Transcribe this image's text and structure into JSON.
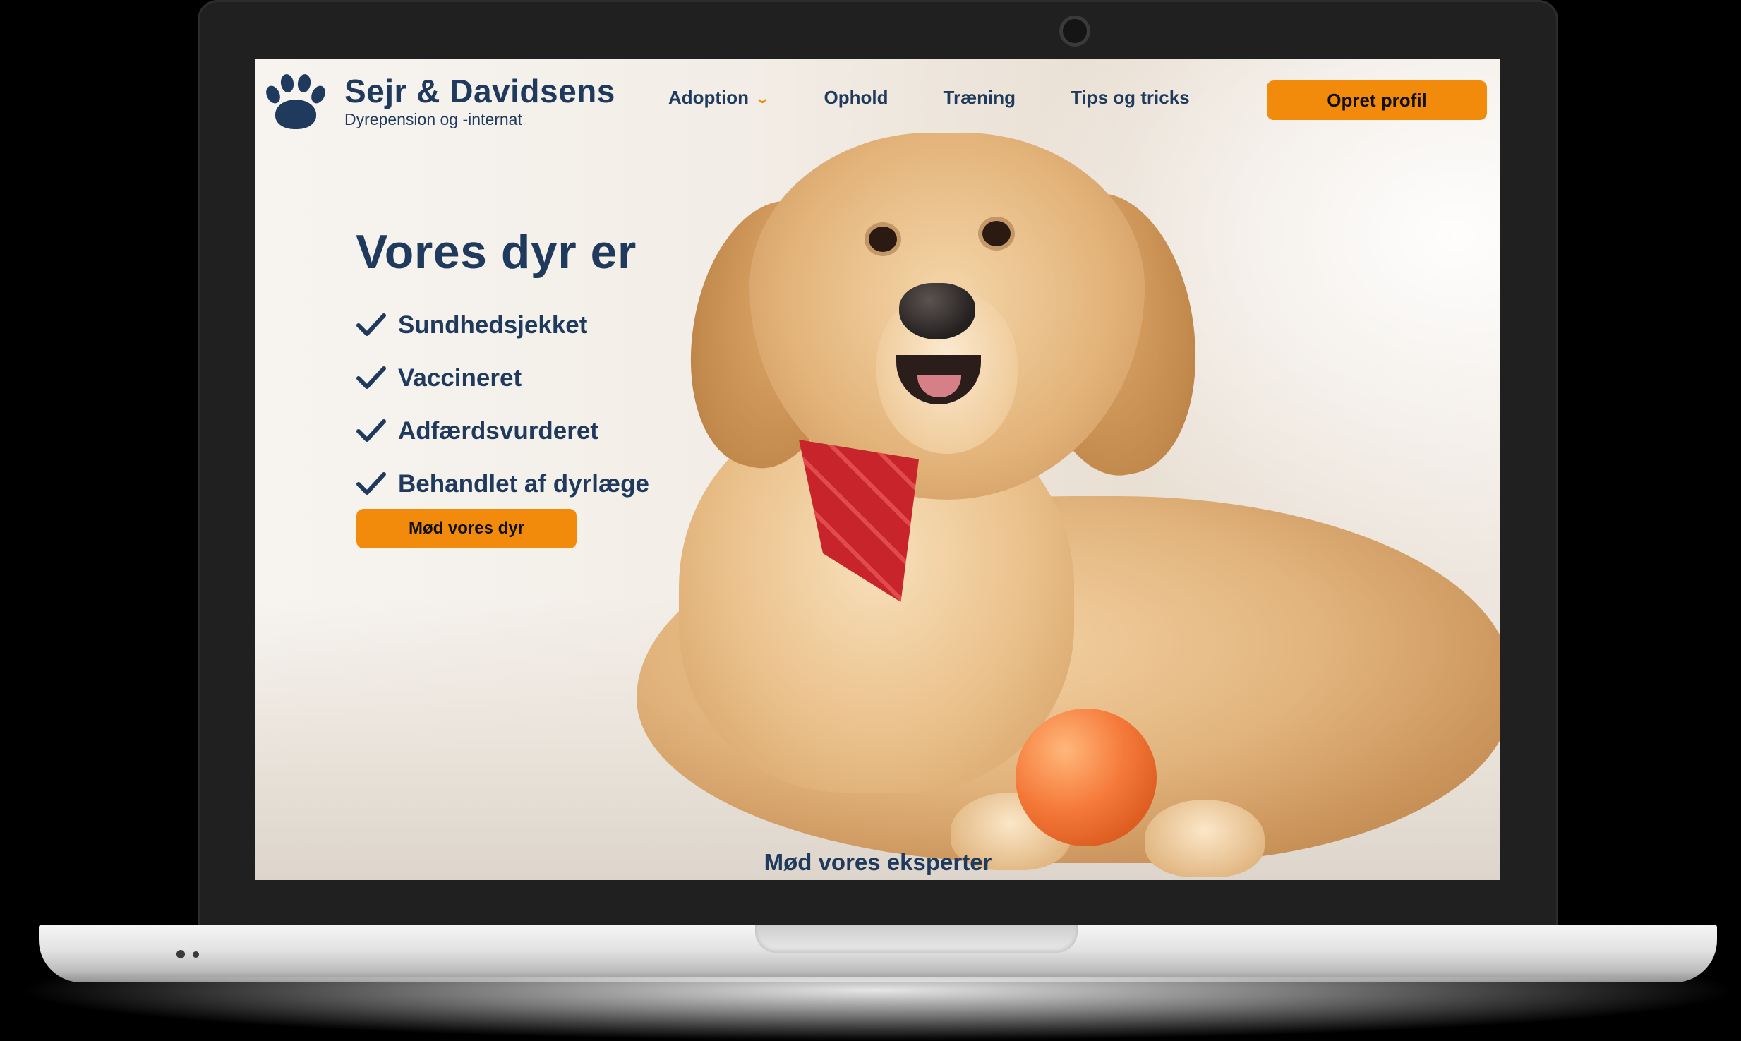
{
  "header": {
    "brand_name": "Sejr & Davidsens",
    "brand_tagline": "Dyrepension og -internat",
    "logo_icon": "paw-icon",
    "nav": [
      {
        "label": "Adoption",
        "has_dropdown": true
      },
      {
        "label": "Ophold"
      },
      {
        "label": "Træning"
      },
      {
        "label": "Tips og tricks"
      }
    ],
    "profile_button": "Opret profil"
  },
  "hero": {
    "title": "Vores dyr er",
    "checklist": [
      "Sundhedsjekket",
      "Vaccineret",
      "Adfærdsvurderet",
      "Behandlet af dyrlæge"
    ],
    "cta": "Mød vores dyr",
    "image_icon": "dog-with-ball-photo"
  },
  "next_section": {
    "heading": "Mød vores eksperter"
  },
  "colors": {
    "primary_navy": "#1f3a5c",
    "accent_orange": "#f28a0c",
    "laptop_bezel": "#202020"
  }
}
